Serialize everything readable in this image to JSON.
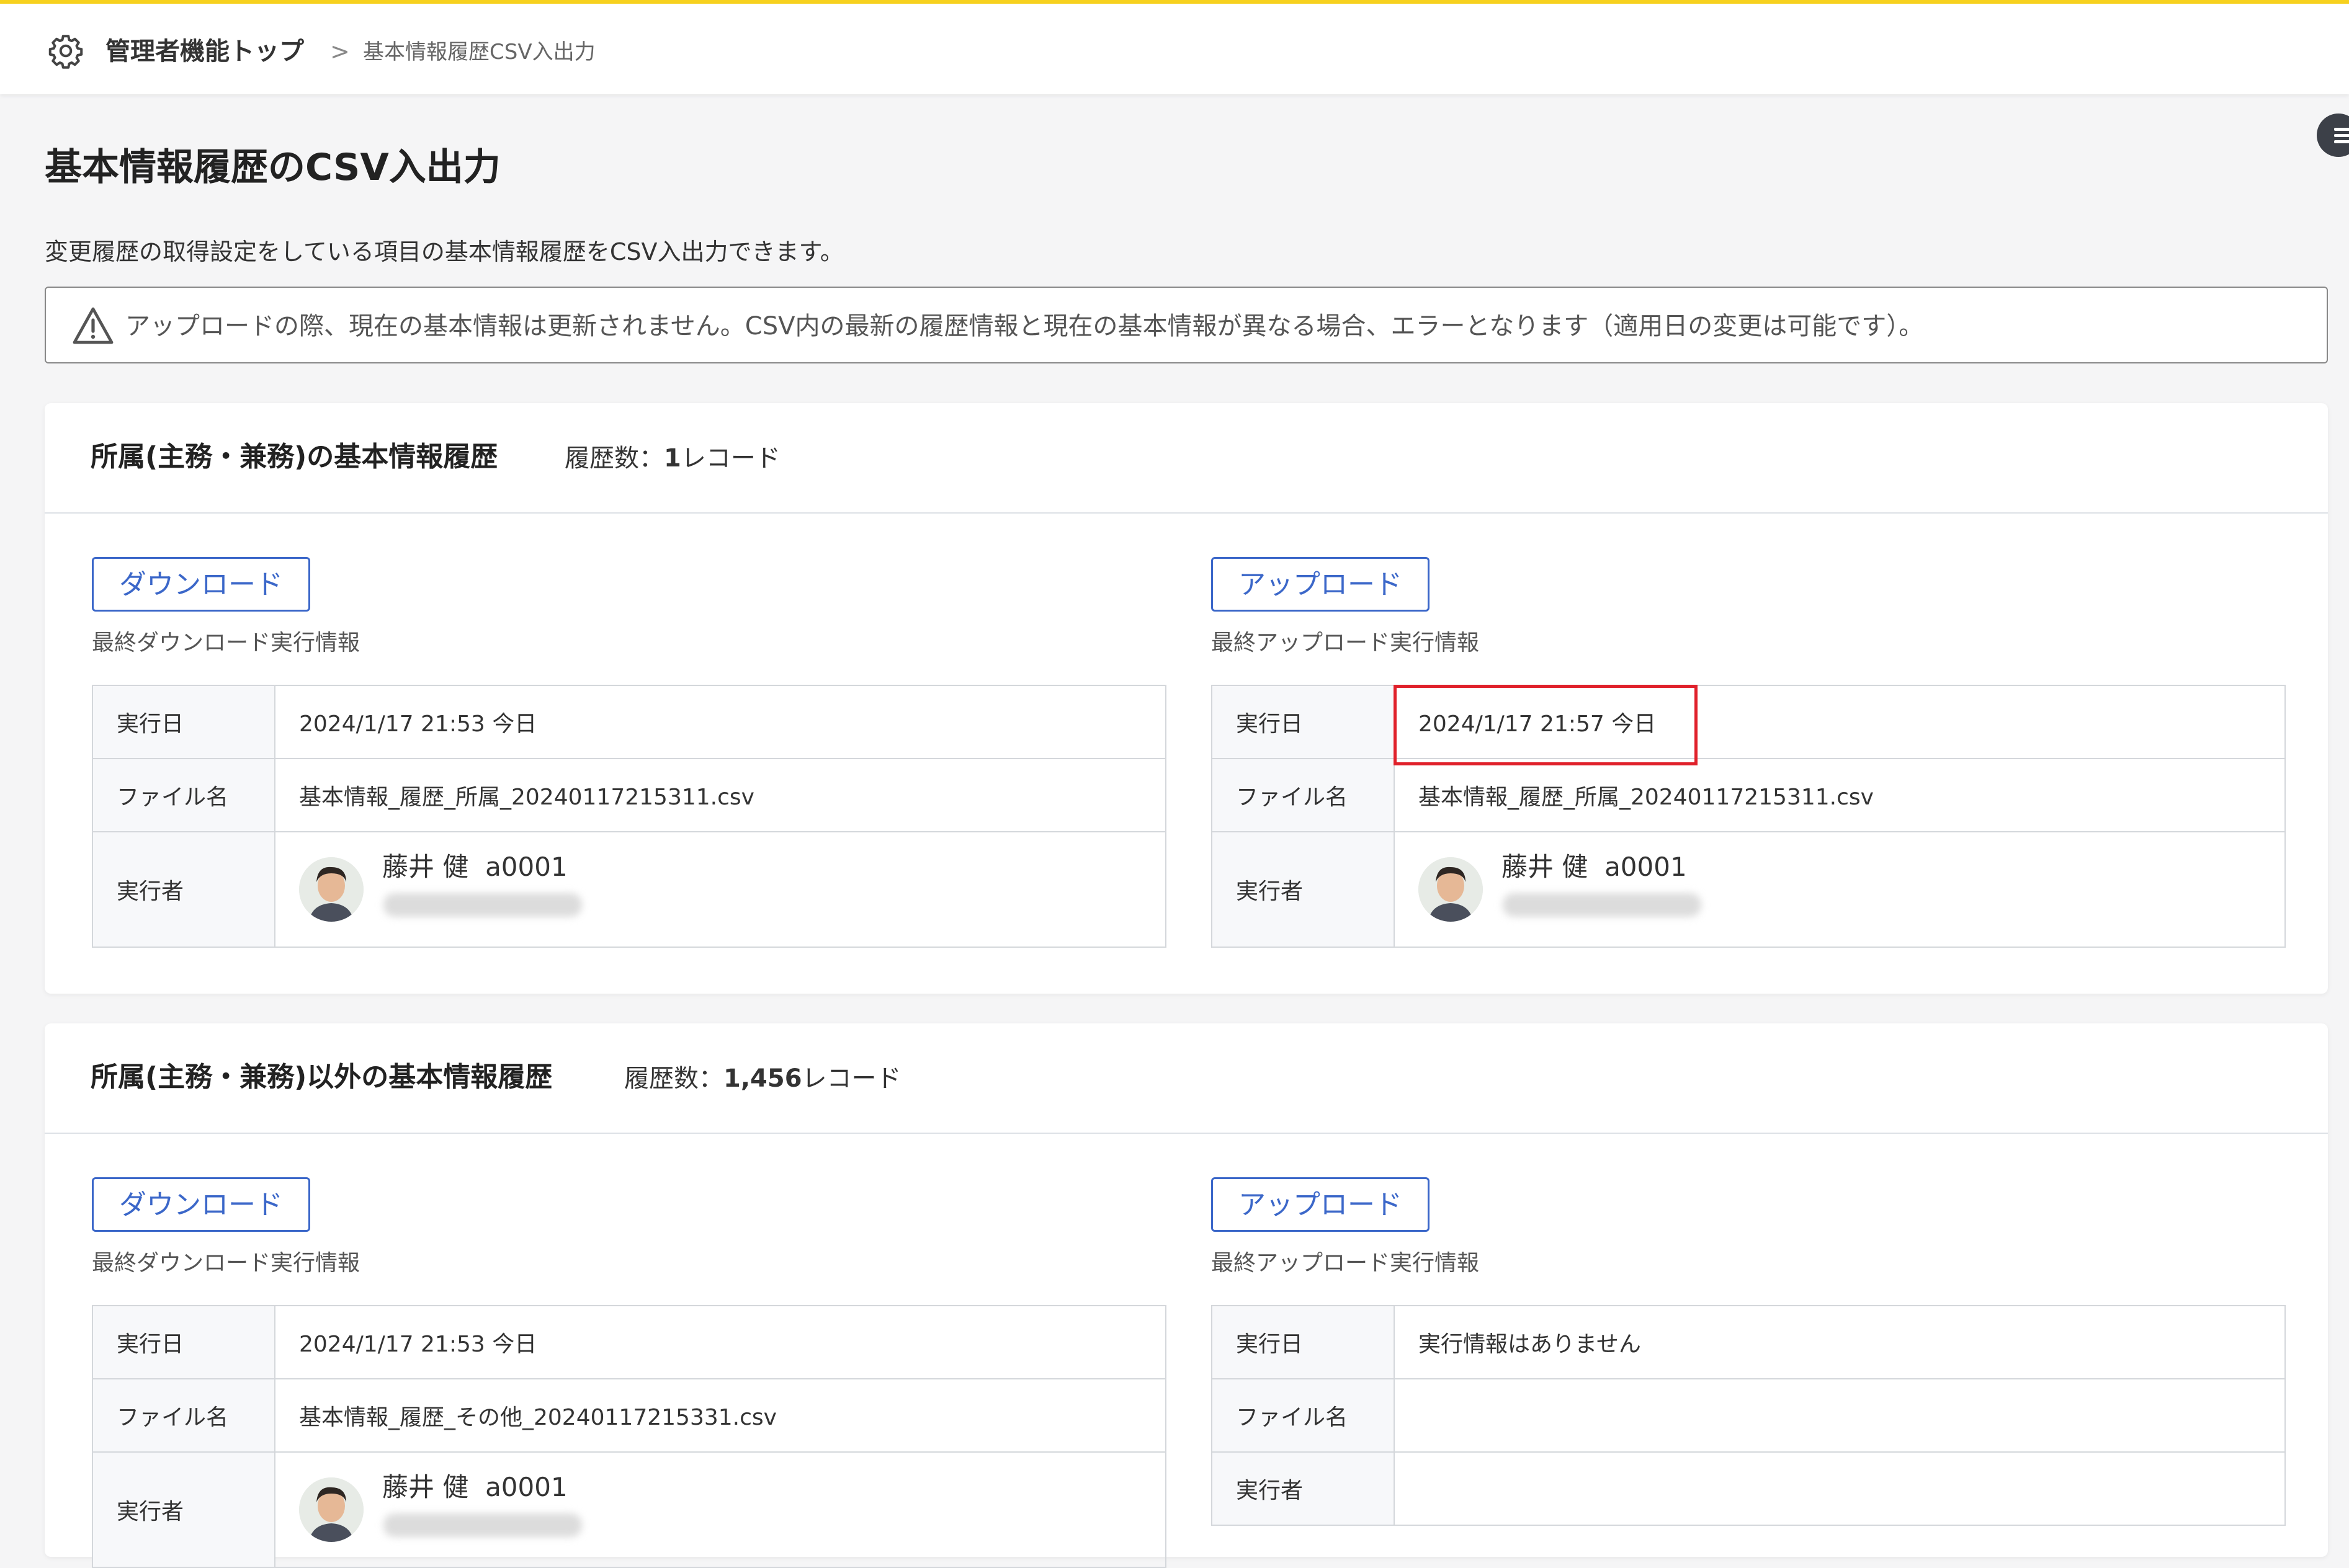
{
  "breadcrumb": {
    "top": "管理者機能トップ",
    "separator": ">",
    "current": "基本情報履歴CSV入出力"
  },
  "page": {
    "title": "基本情報履歴のCSV入出力",
    "description": "変更履歴の取得設定をしている項目の基本情報履歴をCSV入出力できます。",
    "notice": "アップロードの際、現在の基本情報は更新されません。CSV内の最新の履歴情報と現在の基本情報が異なる場合、エラーとなります（適用日の変更は可能です）。"
  },
  "labels": {
    "download_button": "ダウンロード",
    "upload_button": "アップロード",
    "last_download": "最終ダウンロード実行情報",
    "last_upload": "最終アップロード実行情報",
    "exec_date": "実行日",
    "file_name": "ファイル名",
    "executor": "実行者",
    "count_prefix": "履歴数：",
    "count_suffix": "レコード"
  },
  "sections": [
    {
      "title": "所属(主務・兼務)の基本情報履歴",
      "count": "1",
      "download": {
        "date": "2024/1/17 21:53 今日",
        "file": "基本情報_履歴_所属_20240117215311.csv",
        "user": "藤井 健",
        "user_id": "a0001"
      },
      "upload": {
        "date": "2024/1/17 21:57 今日",
        "file": "基本情報_履歴_所属_20240117215311.csv",
        "user": "藤井 健",
        "user_id": "a0001"
      }
    },
    {
      "title": "所属(主務・兼務)以外の基本情報履歴",
      "count": "1,456",
      "download": {
        "date": "2024/1/17 21:53 今日",
        "file": "基本情報_履歴_その他_20240117215331.csv",
        "user": "藤井 健",
        "user_id": "a0001"
      },
      "upload": {
        "date": "実行情報はありません",
        "file": "",
        "user": ""
      }
    }
  ],
  "colors": {
    "accent": "#3b67c9",
    "top_bar": "#f7d11e",
    "highlight": "#e0202a"
  },
  "icons": {
    "settings": "gear-icon",
    "warning": "warning-icon",
    "side_menu": "menu-icon"
  }
}
